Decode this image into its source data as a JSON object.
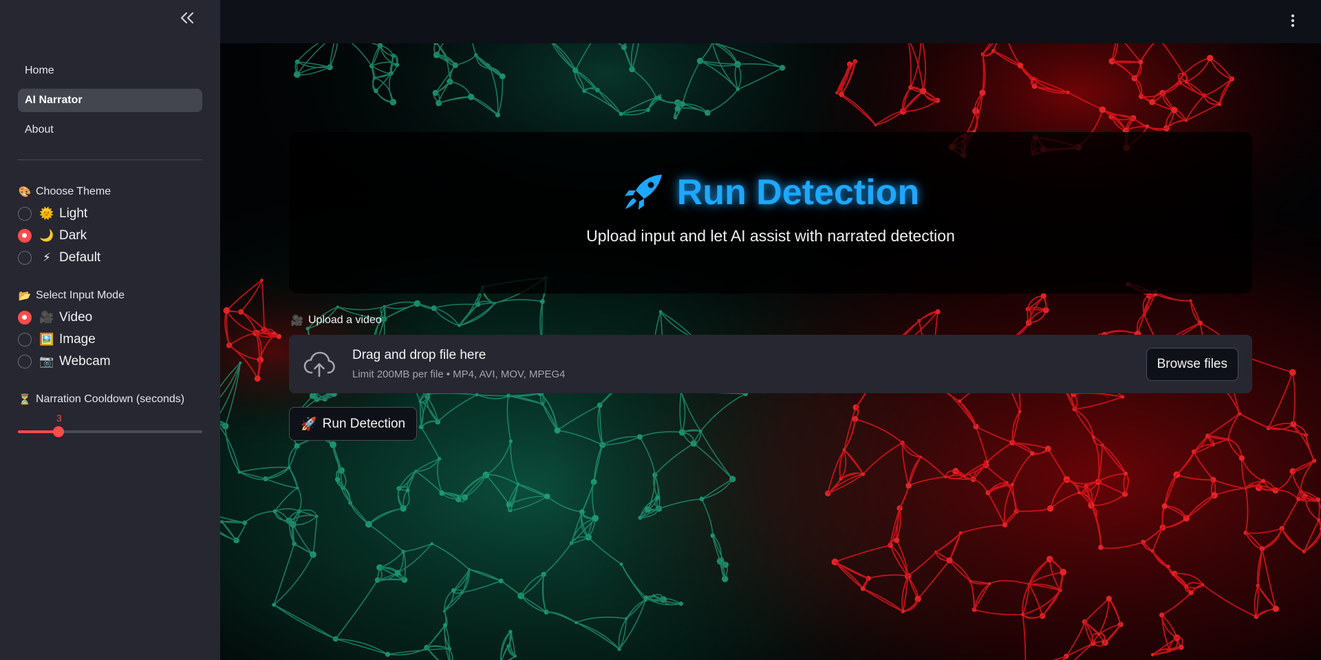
{
  "sidebar": {
    "nav": [
      {
        "label": "Home",
        "active": false
      },
      {
        "label": "AI Narrator",
        "active": true
      },
      {
        "label": "About",
        "active": false
      }
    ],
    "theme": {
      "label": "Choose Theme",
      "icon": "palette-icon",
      "options": [
        {
          "emoji": "🌞",
          "label": "Light",
          "checked": false
        },
        {
          "emoji": "🌙",
          "label": "Dark",
          "checked": true
        },
        {
          "emoji": "⚡",
          "label": "Default",
          "checked": false
        }
      ]
    },
    "input_mode": {
      "label": "Select Input Mode",
      "icon": "folder-icon",
      "options": [
        {
          "emoji": "🎥",
          "label": "Video",
          "checked": true
        },
        {
          "emoji": "🖼️",
          "label": "Image",
          "checked": false
        },
        {
          "emoji": "📷",
          "label": "Webcam",
          "checked": false
        }
      ]
    },
    "cooldown": {
      "label": "Narration Cooldown (seconds)",
      "icon": "hourglass-icon",
      "value": "3",
      "fraction": 0.22
    }
  },
  "hero": {
    "icon": "rocket-icon",
    "title": "Run Detection",
    "subtitle": "Upload input and let AI assist with narrated detection"
  },
  "uploader": {
    "label": "Upload a video",
    "icon": "video-camera-icon",
    "drop_text": "Drag and drop file here",
    "limit_text": "Limit 200MB per file • MP4, AVI, MOV, MPEG4",
    "browse_label": "Browse files"
  },
  "run_button": {
    "emoji": "🚀",
    "label": "Run Detection"
  },
  "colors": {
    "accent": "#ff4b4b",
    "title_glow": "#1ea7ff",
    "sidebar_bg": "#262730",
    "app_bg": "#0e1117"
  }
}
